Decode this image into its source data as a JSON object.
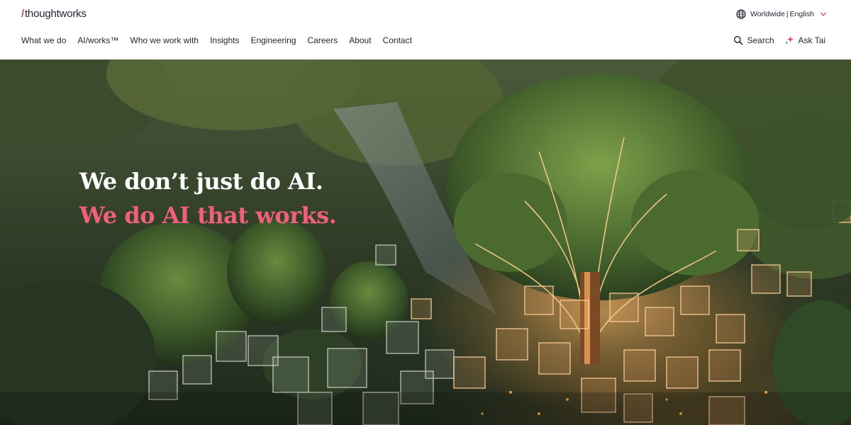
{
  "brand": {
    "slash": "/",
    "name": "thoughtworks"
  },
  "locale": {
    "region": "Worldwide",
    "separator": "|",
    "language": "English",
    "icon": "globe-icon"
  },
  "nav": {
    "items": [
      {
        "label": "What we do"
      },
      {
        "label": "AI/works™"
      },
      {
        "label": "Who we work with"
      },
      {
        "label": "Insights"
      },
      {
        "label": "Engineering"
      },
      {
        "label": "Careers"
      },
      {
        "label": "About"
      },
      {
        "label": "Contact"
      }
    ]
  },
  "actions": {
    "search_label": "Search",
    "ask_label": "Ask Tai"
  },
  "hero": {
    "headline_line1": "We don’t just do AI.",
    "headline_line2": "We do AI that works."
  },
  "colors": {
    "accent": "#e0455b",
    "headline_accent": "#f0607a",
    "text": "#1e2433"
  }
}
